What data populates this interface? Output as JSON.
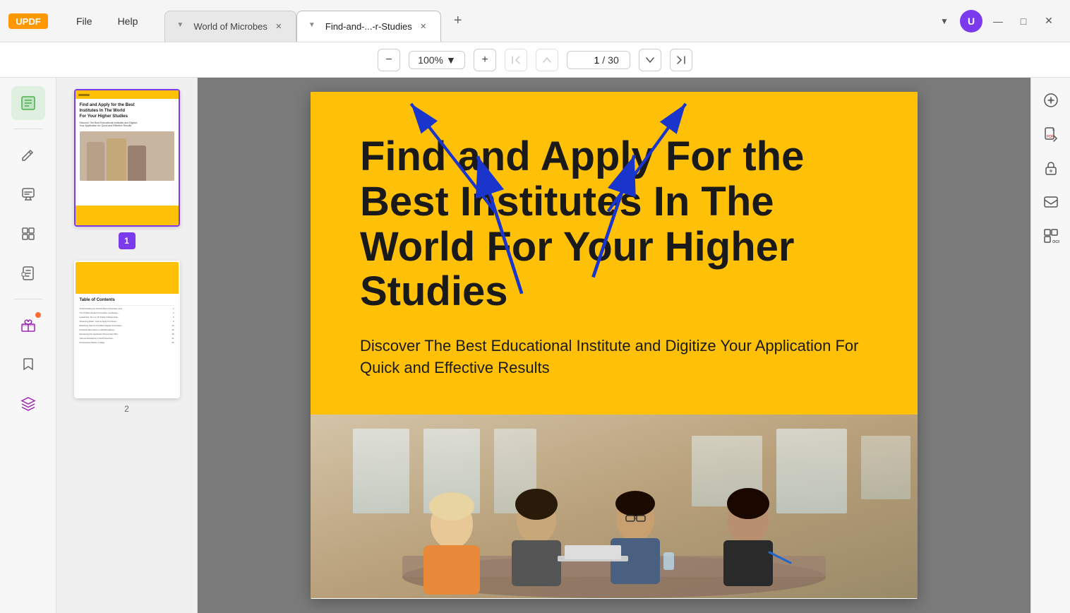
{
  "app": {
    "logo": "UPDF",
    "menu": [
      "File",
      "Help"
    ]
  },
  "tabs": [
    {
      "label": "World of Microbes",
      "active": false,
      "id": "tab-world-microbes"
    },
    {
      "label": "Find-and-...-r-Studies",
      "active": true,
      "id": "tab-find-studies"
    }
  ],
  "tab_add_label": "+",
  "window_controls": {
    "minimize": "—",
    "maximize": "□",
    "close": "✕"
  },
  "user": {
    "initial": "U"
  },
  "toolbar": {
    "zoom_out_label": "−",
    "zoom_level": "100%",
    "zoom_in_label": "+",
    "first_page_label": "⏮",
    "prev_page_label": "▲",
    "current_page": "1",
    "total_pages": "30",
    "next_page_label": "▼",
    "last_page_label": "⏭"
  },
  "left_sidebar": {
    "icons": [
      {
        "name": "thumbnails-icon",
        "symbol": "☰",
        "active": true
      },
      {
        "name": "edit-icon",
        "symbol": "✏️",
        "active": false
      },
      {
        "name": "annotate-icon",
        "symbol": "📝",
        "active": false
      },
      {
        "name": "organize-icon",
        "symbol": "⊞",
        "active": false
      },
      {
        "name": "extract-icon",
        "symbol": "⊟",
        "active": false
      },
      {
        "name": "gift-icon",
        "symbol": "🎁",
        "active": false,
        "badge": true
      },
      {
        "name": "bookmark-icon",
        "symbol": "🔖",
        "active": false
      },
      {
        "name": "layers-icon",
        "symbol": "⬡",
        "active": false
      }
    ]
  },
  "thumbnails": [
    {
      "page_num": "1",
      "selected": true,
      "label": "1"
    },
    {
      "page_num": "2",
      "selected": false,
      "label": "2"
    }
  ],
  "right_sidebar": {
    "icons": [
      {
        "name": "ai-icon",
        "symbol": "🤖"
      },
      {
        "name": "pdf-convert-icon",
        "symbol": "📄"
      },
      {
        "name": "lock-icon",
        "symbol": "🔒"
      },
      {
        "name": "mail-icon",
        "symbol": "✉"
      },
      {
        "name": "ocr-icon",
        "symbol": "▦"
      }
    ]
  },
  "pdf_content": {
    "title": "Find and Apply For the Best Institutes In The World For Your Higher Studies",
    "subtitle": "Discover The Best Educational Institute and Digitize Your Application For Quick and Effective Results"
  },
  "toc_lines": [
    "Understanding the World's Best Universities and World Standards ......... 1",
    "The 10 Best Global Universities: Landscape and World Standards ......... 3",
    "Leadership: the top 15 Global Colleges that Produce the Best Professional Managers ......... 6",
    "Streaming Risks - How to Apply For Direct Your Favorite Institution ......... 9",
    "Effectively Plan for the Effect Digital Universities for Most Courses ......... 12",
    "Practical Alternatives to Multidisciplinary Intensive Scholarships ......... 15",
    "Developing the Application Period that Offer Between Focused Unstructured Studies ......... 18",
    "Various Admissions in North American Universities ......... 21",
    "Prerequisites Before a Stage ......... 24"
  ]
}
